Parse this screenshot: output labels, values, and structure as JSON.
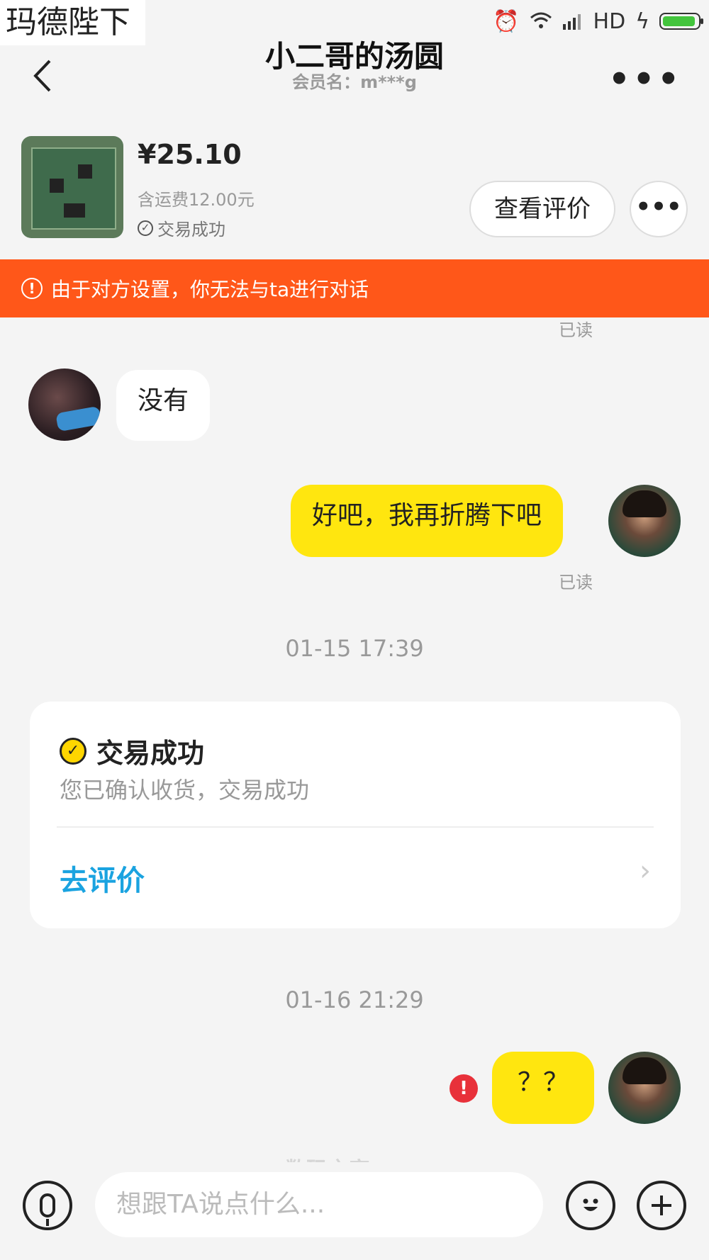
{
  "watermark_top": "玛德陛下",
  "status_bar": {
    "network": "HD",
    "alarm_icon": "alarm-icon",
    "wifi_icon": "wifi-icon",
    "signal_icon": "signal-icon",
    "battery_icon": "battery-icon"
  },
  "header": {
    "title": "小二哥的汤圆",
    "subtitle": "会员名：m***g"
  },
  "product": {
    "price": "¥25.10",
    "shipping": "含运费12.00元",
    "status": "交易成功",
    "review_button": "查看评价"
  },
  "warning": "由于对方设置，你无法与ta进行对话",
  "messages": {
    "read_top": "已读",
    "msg1": "没有",
    "msg2": "好吧，我再折腾下吧",
    "read_msg2": "已读",
    "time1": "01-15 17:39",
    "card": {
      "title": "交易成功",
      "desc": "您已确认收货，交易成功",
      "link": "去评价"
    },
    "time2": "01-16 21:29",
    "msg3": "？？"
  },
  "input_bar": {
    "placeholder": "想跟TA说点什么..."
  },
  "watermark_bottom": "数码之家"
}
